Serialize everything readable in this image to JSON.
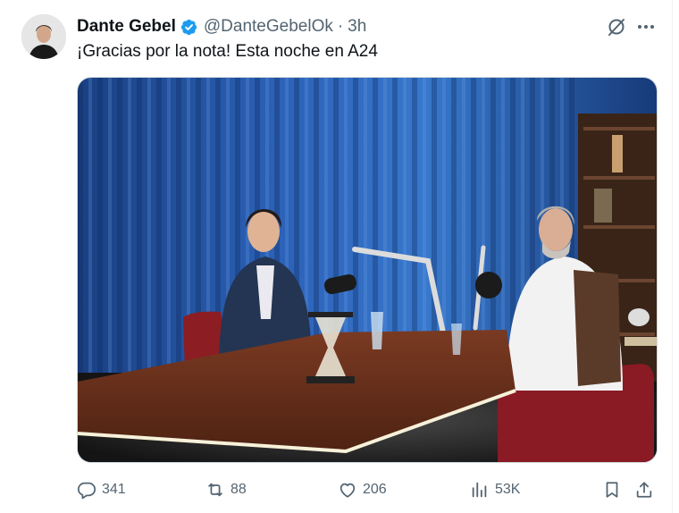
{
  "author": {
    "name": "Dante Gebel",
    "handle": "@DanteGebelOk",
    "separator": "·",
    "time": "3h"
  },
  "tweet": {
    "text": "¡Gracias por la nota! Esta noche en A24"
  },
  "metrics": {
    "replies": "341",
    "retweets": "88",
    "likes": "206",
    "views": "53K"
  },
  "colors": {
    "verified": "#1d9bf0",
    "secondary_text": "#536471",
    "primary_text": "#0f1419"
  },
  "icons": [
    "grok-icon",
    "more-icon",
    "verified-icon",
    "reply-icon",
    "retweet-icon",
    "like-icon",
    "views-icon",
    "bookmark-icon",
    "share-icon"
  ]
}
